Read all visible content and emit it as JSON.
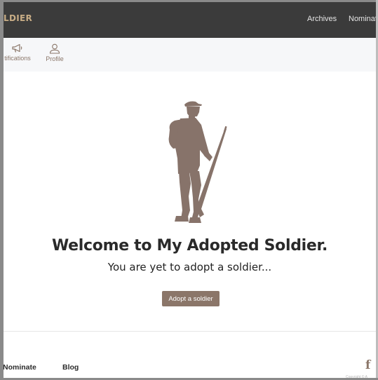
{
  "header": {
    "brand": "LDIER",
    "nav": [
      "Archives",
      "Nominate"
    ]
  },
  "subnav": {
    "notifications_label": "tifications",
    "profile_label": "Profile"
  },
  "hero": {
    "title": "Welcome to My Adopted Soldier.",
    "subtitle": "You are yet to adopt a soldier...",
    "button_label": "Adopt a soldier"
  },
  "footer": {
    "links": [
      "Nominate",
      "Blog"
    ],
    "facebook_icon": "f",
    "copyright": "Copyright © A"
  },
  "colors": {
    "topbar": "#3b3b3b",
    "brand": "#c8ad86",
    "accent": "#8b7669"
  }
}
